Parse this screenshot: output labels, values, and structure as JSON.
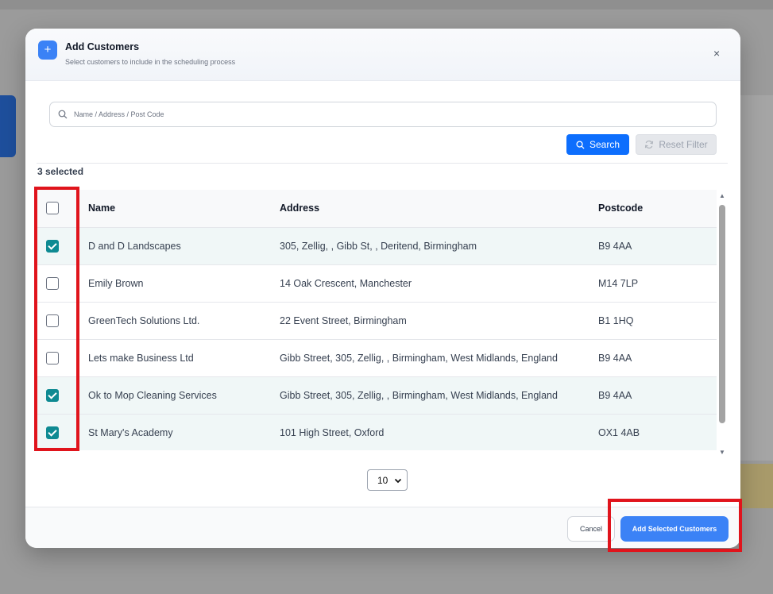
{
  "modal": {
    "badge": "+",
    "title": "Add Customers",
    "subtitle": "Select customers to include in the scheduling process",
    "close": "×"
  },
  "search": {
    "placeholder": "Name / Address / Post Code",
    "value": "",
    "search_label": "Search",
    "reset_label": "Reset Filter"
  },
  "selection": {
    "count_text": "3 selected"
  },
  "table": {
    "headers": {
      "name": "Name",
      "address": "Address",
      "postcode": "Postcode"
    },
    "rows": [
      {
        "name": "D and D Landscapes",
        "address": "305, Zellig, , Gibb St, , Deritend, Birmingham",
        "postcode": "B9 4AA",
        "selected": true
      },
      {
        "name": "Emily Brown",
        "address": "14 Oak Crescent, Manchester",
        "postcode": "M14 7LP",
        "selected": false
      },
      {
        "name": "GreenTech Solutions Ltd.",
        "address": "22 Event Street, Birmingham",
        "postcode": "B1 1HQ",
        "selected": false
      },
      {
        "name": "Lets make Business Ltd",
        "address": "Gibb Street, 305, Zellig, , Birmingham, West Midlands, England",
        "postcode": "B9 4AA",
        "selected": false
      },
      {
        "name": "Ok to Mop Cleaning Services",
        "address": "Gibb Street, 305, Zellig, , Birmingham, West Midlands, England",
        "postcode": "B9 4AA",
        "selected": true
      },
      {
        "name": "St Mary's Academy",
        "address": "101 High Street, Oxford",
        "postcode": "OX1 4AB",
        "selected": true
      }
    ]
  },
  "pagination": {
    "page_size": "10"
  },
  "footer": {
    "cancel_label": "Cancel",
    "add_label": "Add Selected Customers"
  },
  "colors": {
    "primary": "#3b82f6",
    "search_button": "#0d6efd",
    "checkbox_checked": "#0e8a92",
    "highlight": "#e0141c"
  }
}
